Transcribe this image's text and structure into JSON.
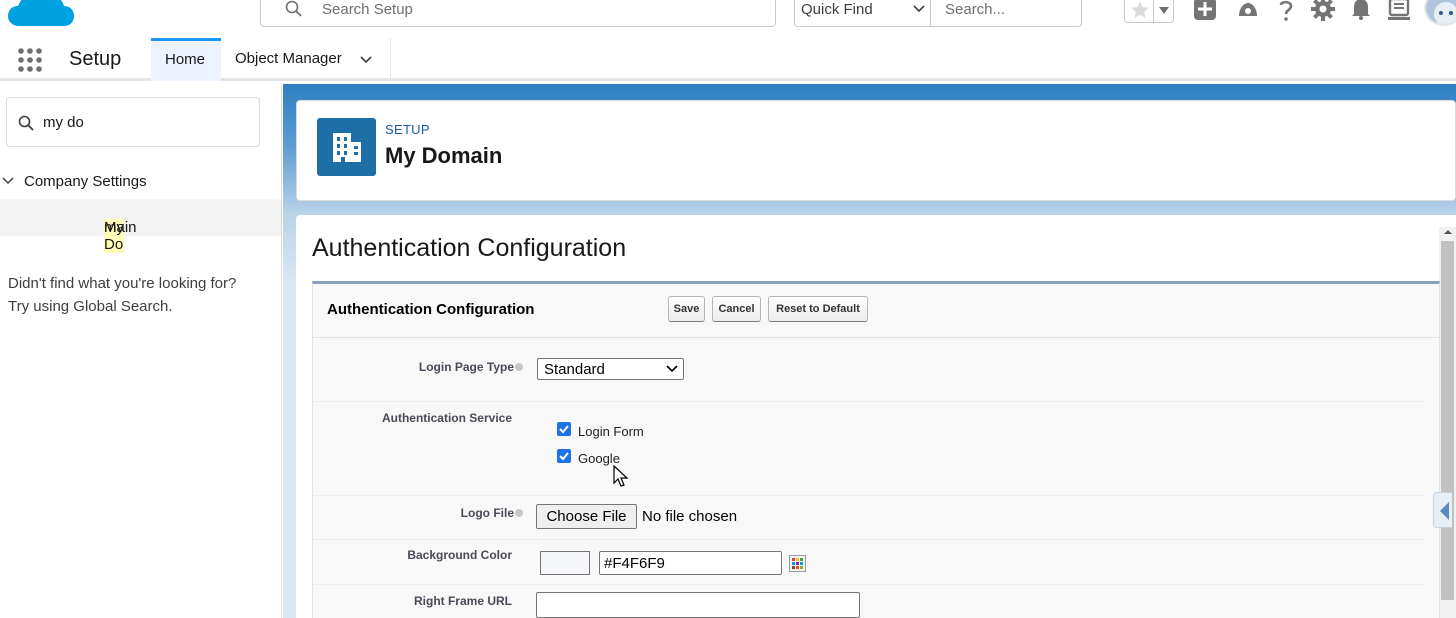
{
  "global_header": {
    "search_placeholder": "Search Setup",
    "quick_find_label": "Quick Find",
    "search_placeholder_2": "Search..."
  },
  "context_bar": {
    "app_name": "Setup",
    "tabs": [
      {
        "label": "Home",
        "active": true
      },
      {
        "label": "Object Manager",
        "active": false
      }
    ]
  },
  "sidebar": {
    "quick_find_value": "my do",
    "tree": {
      "group_label": "Company Settings",
      "item_label_highlight": "My Do",
      "item_label_rest": "main"
    },
    "not_found_line1": "Didn't find what you're looking for?",
    "not_found_line2": "Try using Global Search."
  },
  "page_header": {
    "eyebrow": "SETUP",
    "title": "My Domain"
  },
  "content": {
    "title": "Authentication Configuration",
    "block_title": "Authentication Configuration",
    "buttons": {
      "save": "Save",
      "cancel": "Cancel",
      "reset": "Reset to Default"
    },
    "fields": {
      "login_page_type_label": "Login Page Type",
      "login_page_type_value": "Standard",
      "auth_service_label": "Authentication Service",
      "auth_services": [
        {
          "label": "Login Form",
          "checked": true
        },
        {
          "label": "Google",
          "checked": true
        }
      ],
      "logo_file_label": "Logo File",
      "choose_file_label": "Choose File",
      "no_file_text": "No file chosen",
      "background_color_label": "Background Color",
      "background_color_value": "#F4F6F9",
      "right_frame_url_label": "Right Frame URL",
      "right_frame_url_value": ""
    }
  },
  "colors": {
    "brand_blue": "#00a1e0",
    "tab_active_border": "#1b96ff",
    "page_icon_bg": "#1e6fa8",
    "checkbox": "#1a73e8",
    "swatch": "#f4f6f9"
  }
}
